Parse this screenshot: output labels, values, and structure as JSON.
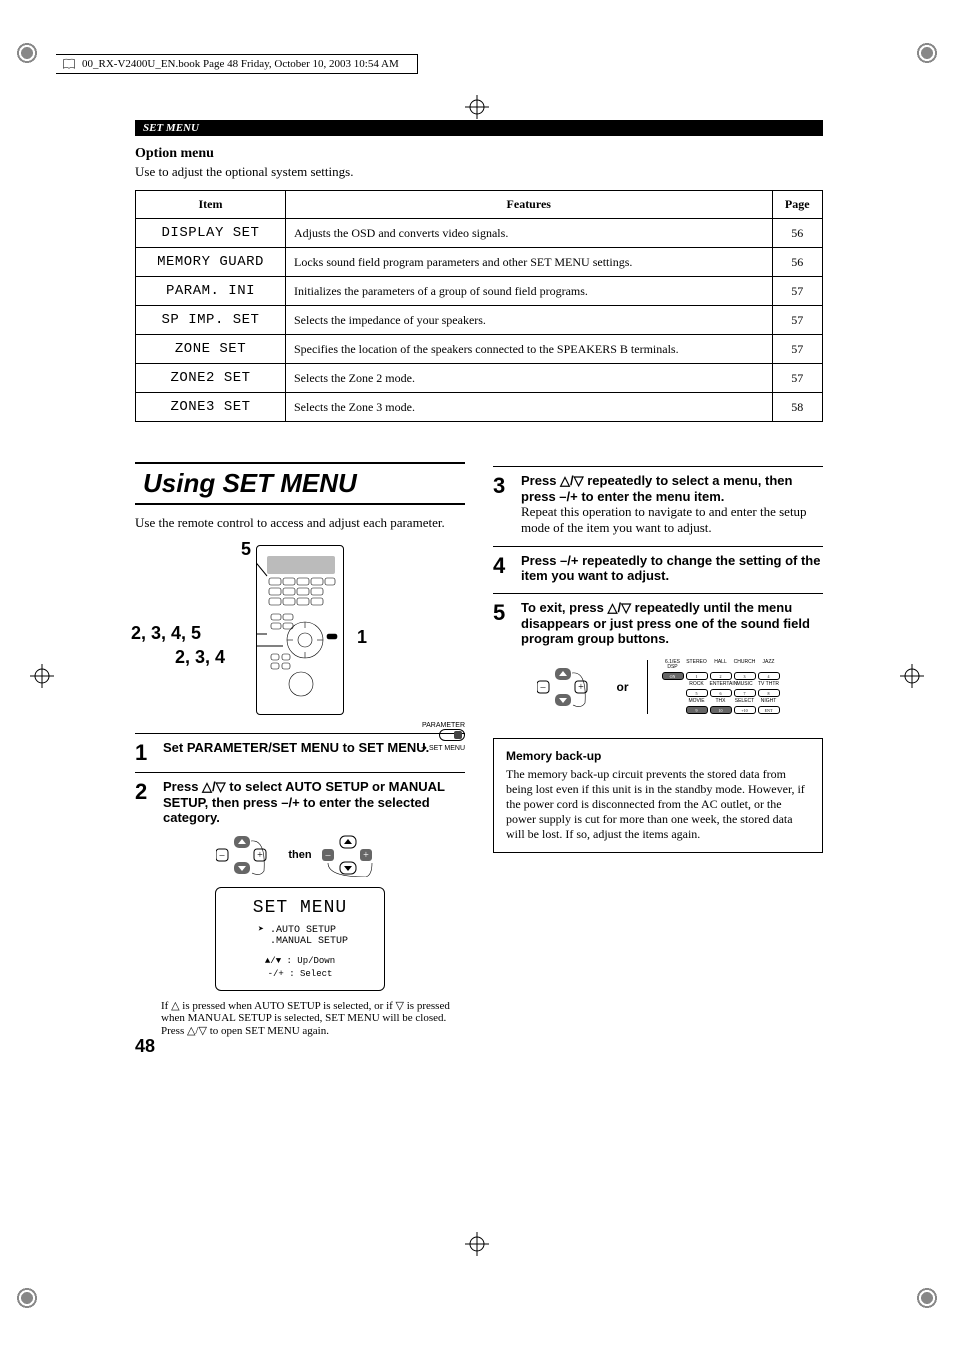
{
  "book_header": "00_RX-V2400U_EN.book  Page 48  Friday, October 10, 2003  10:54 AM",
  "section_label": "SET MENU",
  "option": {
    "title": "Option menu",
    "desc": "Use to adjust the optional system settings.",
    "headers": {
      "item": "Item",
      "features": "Features",
      "page": "Page"
    },
    "rows": [
      {
        "item": "DISPLAY SET",
        "features": "Adjusts the OSD and converts video signals.",
        "page": "56"
      },
      {
        "item": "MEMORY GUARD",
        "features": "Locks sound field program parameters and other SET MENU settings.",
        "page": "56"
      },
      {
        "item": "PARAM. INI",
        "features": "Initializes the parameters of a group of sound field programs.",
        "page": "57"
      },
      {
        "item": "SP IMP. SET",
        "features": "Selects the impedance of your speakers.",
        "page": "57"
      },
      {
        "item": "ZONE SET",
        "features": "Specifies the location of the speakers connected to the SPEAKERS B terminals.",
        "page": "57"
      },
      {
        "item": "ZONE2 SET",
        "features": "Selects the Zone 2 mode.",
        "page": "57"
      },
      {
        "item": "ZONE3 SET",
        "features": "Selects the Zone 3 mode.",
        "page": "58"
      }
    ]
  },
  "using": {
    "heading": "Using SET MENU",
    "intro": "Use the remote control to access and adjust each parameter.",
    "remote_labels": {
      "top": "5",
      "left1": "2, 3, 4, 5",
      "left2": "2, 3, 4",
      "right": "1"
    },
    "switch_labels": {
      "top": "PARAMETER",
      "bottom": "SET MENU"
    },
    "osd": {
      "title": "SET MENU",
      "items": [
        "AUTO SETUP",
        "MANUAL SETUP"
      ],
      "hint1": "Up/Down",
      "hint2": "Select"
    },
    "then": "then",
    "or": "or",
    "grid": {
      "row1_labels": [
        "6.1/ES DSP",
        "STEREO",
        "HALL",
        "CHURCH",
        "JAZZ"
      ],
      "row1_btns": [
        "ON",
        "1",
        "2",
        "3",
        "4"
      ],
      "row2_labels": [
        "ROCK",
        "ENTERTAIN",
        "MUSIC",
        "TV THTR"
      ],
      "row2_btns": [
        "5",
        "6",
        "7",
        "8"
      ],
      "row3_labels": [
        "MOVIE",
        "THX",
        "SELECT",
        "NIGHT"
      ],
      "row3_btns": [
        "9",
        "10",
        "+10",
        "ENT"
      ]
    },
    "step1": {
      "bold": "Set PARAMETER/SET MENU to SET MENU."
    },
    "step2": {
      "bold": "Press △/▽ to select AUTO SETUP or MANUAL SETUP, then press –/+ to enter the selected category.",
      "note": "If △ is pressed when AUTO SETUP is selected, or if ▽ is pressed when MANUAL SETUP is selected, SET MENU will be closed. Press △/▽ to open SET MENU again."
    },
    "step3": {
      "bold": "Press △/▽ repeatedly to select a menu, then press –/+ to enter the menu item.",
      "body": "Repeat this operation to navigate to and enter the setup mode of the item you want to adjust."
    },
    "step4": {
      "bold": "Press –/+ repeatedly to change the setting of the item you want to adjust."
    },
    "step5": {
      "bold": "To exit, press △/▽ repeatedly until the menu disappears or just press one of the sound field program group buttons."
    },
    "memory": {
      "title": "Memory back-up",
      "body": "The memory back-up circuit prevents the stored data from being lost even if this unit is in the standby mode. However, if the power cord is disconnected from the AC outlet, or the power supply is cut for more than one week, the stored data will be lost. If so, adjust the items again."
    }
  },
  "page_number": "48"
}
